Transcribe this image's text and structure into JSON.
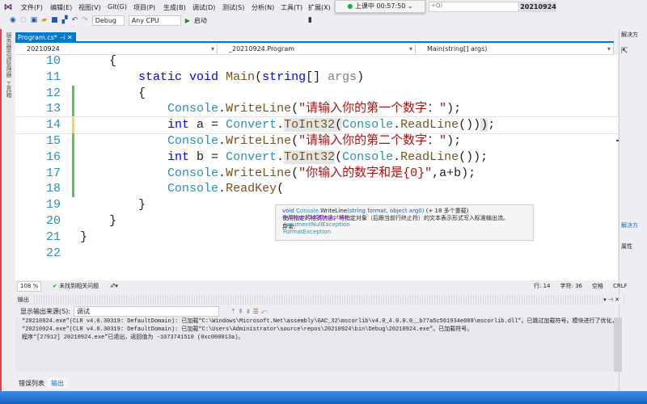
{
  "menu": [
    "文件(F)",
    "编辑(E)",
    "视图(V)",
    "Git(G)",
    "项目(P)",
    "生成(B)",
    "调试(D)",
    "测试(S)",
    "分析(N)",
    "工具(T)",
    "扩展(X)"
  ],
  "search": {
    "placeholder": "+Q)"
  },
  "solution_title": "20210924",
  "timer": {
    "label": "上课中 00:57:50",
    "status_color": "#20b040"
  },
  "toolbar": {
    "config": "Debug",
    "platform": "Any CPU",
    "start": "启动"
  },
  "left_tabs": [
    "服务器资源管理器",
    "工具箱"
  ],
  "tab": {
    "label": "Program.cs*",
    "pin": "⊣",
    "close": "✕"
  },
  "nav": {
    "project": "20210924",
    "class": "_20210924.Program",
    "member": "Main(string[] args)"
  },
  "code_lines": [
    {
      "n": "10",
      "indent": "    ",
      "html": "{"
    },
    {
      "n": "11",
      "indent": "        ",
      "parts": [
        [
          "kw",
          "static"
        ],
        [
          "",
          " "
        ],
        [
          "kw",
          "void"
        ],
        [
          "",
          " "
        ],
        [
          "mt",
          "Main"
        ],
        [
          "",
          "("
        ],
        [
          "kw",
          "string"
        ],
        [
          "",
          "[] "
        ],
        [
          "pm",
          "args"
        ],
        [
          "",
          ")"
        ]
      ]
    },
    {
      "n": "12",
      "indent": "        ",
      "parts": [
        [
          "",
          "{"
        ]
      ]
    },
    {
      "n": "13",
      "indent": "            ",
      "parts": [
        [
          "ty",
          "Console"
        ],
        [
          "",
          "."
        ],
        [
          "mt",
          "WriteLine"
        ],
        [
          "",
          "("
        ],
        [
          "st",
          "\"请输入你的第一个数字：\""
        ],
        [
          "",
          ");"
        ]
      ]
    },
    {
      "n": "14",
      "indent": "            ",
      "parts": [
        [
          "kw",
          "int"
        ],
        [
          "",
          " a = "
        ],
        [
          "ty",
          "Convert"
        ],
        [
          "",
          "."
        ],
        [
          "mt hl",
          "ToInt32"
        ],
        [
          "hl",
          "("
        ],
        [
          "ty",
          "Console"
        ],
        [
          "",
          "."
        ],
        [
          "mt",
          "ReadLine"
        ],
        [
          "",
          "())"
        ],
        [
          "hl",
          ")"
        ],
        [
          "",
          ";"
        ]
      ]
    },
    {
      "n": "15",
      "indent": "            ",
      "parts": [
        [
          "ty",
          "Console"
        ],
        [
          "",
          "."
        ],
        [
          "mt",
          "WriteLine"
        ],
        [
          "",
          "("
        ],
        [
          "st",
          "\"请输入你的第二个数字：\""
        ],
        [
          "",
          ");"
        ]
      ]
    },
    {
      "n": "16",
      "indent": "            ",
      "parts": [
        [
          "kw",
          "int"
        ],
        [
          "",
          " b = "
        ],
        [
          "ty",
          "Convert"
        ],
        [
          "",
          "."
        ],
        [
          "mt hl",
          "ToInt32"
        ],
        [
          "",
          "("
        ],
        [
          "ty",
          "Console"
        ],
        [
          "",
          "."
        ],
        [
          "mt",
          "ReadLine"
        ],
        [
          "",
          "());"
        ]
      ]
    },
    {
      "n": "17",
      "indent": "            ",
      "parts": [
        [
          "ty",
          "Console"
        ],
        [
          "",
          "."
        ],
        [
          "mt",
          "WriteLine"
        ],
        [
          "",
          "("
        ],
        [
          "st",
          "\"你输入的数字和是{0}\""
        ],
        [
          "",
          ",a+b);"
        ]
      ]
    },
    {
      "n": "18",
      "indent": "            ",
      "parts": [
        [
          "ty",
          "Console"
        ],
        [
          "",
          "."
        ],
        [
          "mt",
          "ReadKey"
        ],
        [
          "",
          "("
        ]
      ]
    },
    {
      "n": "19",
      "indent": "        ",
      "parts": [
        [
          "",
          "}"
        ]
      ]
    },
    {
      "n": "20",
      "indent": "    ",
      "parts": [
        [
          "",
          "}"
        ]
      ]
    },
    {
      "n": "21",
      "indent": "",
      "parts": [
        [
          "",
          "}"
        ]
      ]
    },
    {
      "n": "22",
      "indent": "",
      "parts": []
    }
  ],
  "tooltip": {
    "signature_void": "void",
    "signature_class": "Console.",
    "signature_method": "WriteLine",
    "signature_rest": "(string format, object arg0)",
    "overloads": "(+ 18 多个重载)",
    "description": "使用指定的格式信息，将指定对象（后跟当前行终止符）的文本表示形式写入标准输出流。",
    "exceptions_label": "异常:",
    "exceptions": [
      "System.IO.IOException",
      "ArgumentNullException",
      "FormatException"
    ]
  },
  "status": {
    "zoom": "108 %",
    "issues": "未找到相关问题",
    "line": "行: 14",
    "col": "字符: 36",
    "spaces": "空格",
    "eol": "CRLF"
  },
  "output": {
    "title": "输出",
    "source_label": "显示输出来源(S):",
    "source_value": "调试",
    "lines": [
      "“20210924.exe”(CLR v4.0.30319: DefaultDomain): 已加载“C:\\Windows\\Microsoft.Net\\assembly\\GAC_32\\mscorlib\\v4.0_4.0.0.0__b77a5c561934e089\\mscorlib.dll”。已跳过加载符号。模块进行了优化，并",
      "“20210924.exe”(CLR v4.0.30319: DefaultDomain): 已加载“C:\\Users\\Administrator\\source\\repos\\20210924\\bin\\Debug\\20210924.exe”。已加载符号。",
      "程序“[27912] 20210924.exe”已退出，返回值为 -1073741510 (0xc000013a)。"
    ]
  },
  "bottom_tabs": [
    "错误列表",
    "输出"
  ],
  "right_pane": {
    "title": "解决方",
    "link": "解决方",
    "properties": "属性"
  }
}
